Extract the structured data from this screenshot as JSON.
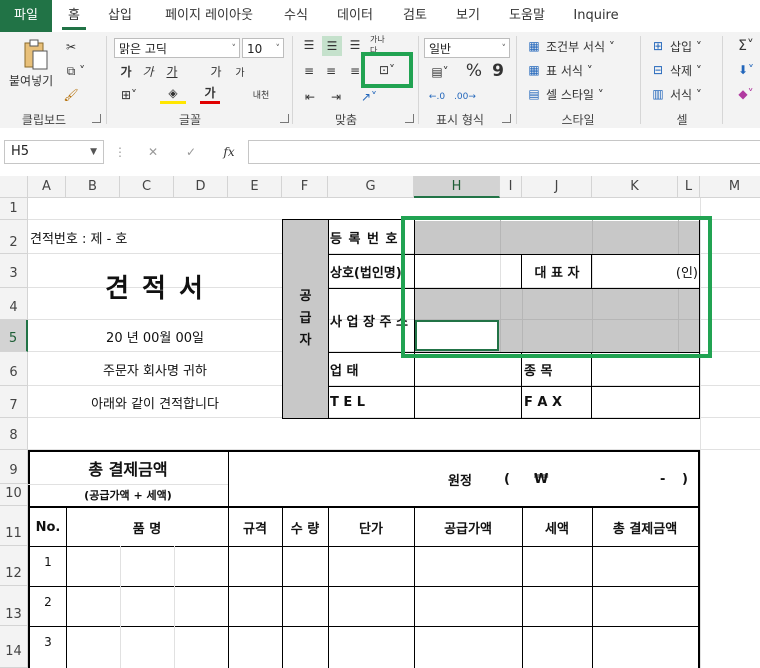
{
  "tabs": [
    "파일",
    "홈",
    "삽입",
    "페이지 레이아웃",
    "수식",
    "데이터",
    "검토",
    "보기",
    "도움말",
    "Inquire"
  ],
  "ribbon": {
    "clipboard": {
      "paste": "붙여넣기",
      "label": "클립보드"
    },
    "font": {
      "name": "맑은 고딕",
      "size": "10",
      "bold": "가",
      "italic": "가",
      "underline": "가",
      "grow": "가",
      "shrink": "가",
      "phonetic": "내천",
      "label": "글꼴"
    },
    "alignment": {
      "label": "맞춤",
      "wrap": "가나다"
    },
    "number": {
      "format": "일반",
      "percent": "%",
      "comma": "9",
      "label": "표시 형식"
    },
    "styles": {
      "conditional": "조건부 서식",
      "table": "표 서식",
      "cell": "셀 스타일",
      "label": "스타일"
    },
    "cells": {
      "insert": "삽입",
      "delete": "삭제",
      "format": "서식",
      "label": "셀"
    },
    "editing": {
      "sum": "Σ"
    }
  },
  "formula_bar": {
    "name_box": "H5",
    "cancel": "✕",
    "enter": "✓",
    "fx": "fx",
    "value": ""
  },
  "columns": [
    "A",
    "B",
    "C",
    "D",
    "E",
    "F",
    "G",
    "H",
    "I",
    "J",
    "K",
    "L",
    "M"
  ],
  "rows": [
    "1",
    "2",
    "3",
    "4",
    "5",
    "6",
    "7",
    "8",
    "9",
    "10",
    "11",
    "12",
    "13",
    "14"
  ],
  "sheet": {
    "quote_no": "견적번호 : 제  -  호",
    "title": "견 적 서",
    "date": "20  년    00월    00일",
    "customer": "주문자 회사명      귀하",
    "greeting": "아래와 같이 견적합니다",
    "supplier": "공\n급\n자",
    "reg_no": "등 록 번 호",
    "company": "상호(법인명)",
    "ceo": "대   표   자",
    "seal": "(인)",
    "address": "사 업 장 주 소",
    "business": "업          태",
    "item": "종          목",
    "tel": "T     E     L",
    "fax": "F     A     X",
    "total_title": "총 결제금액",
    "total_sub": "(공급가액 + 세액)",
    "won": "원정",
    "paren_open": "(",
    "currency": "₩",
    "dash": "-",
    "paren_close": ")",
    "headers": [
      "No.",
      "품     명",
      "규격",
      "수 량",
      "단가",
      "공급가액",
      "세액",
      "총 결제금액"
    ],
    "line_nos": [
      "1",
      "2",
      "3"
    ]
  },
  "colors": {
    "accent": "#217346",
    "highlight": "#21a352",
    "merged_gray": "#c8c8c8"
  }
}
